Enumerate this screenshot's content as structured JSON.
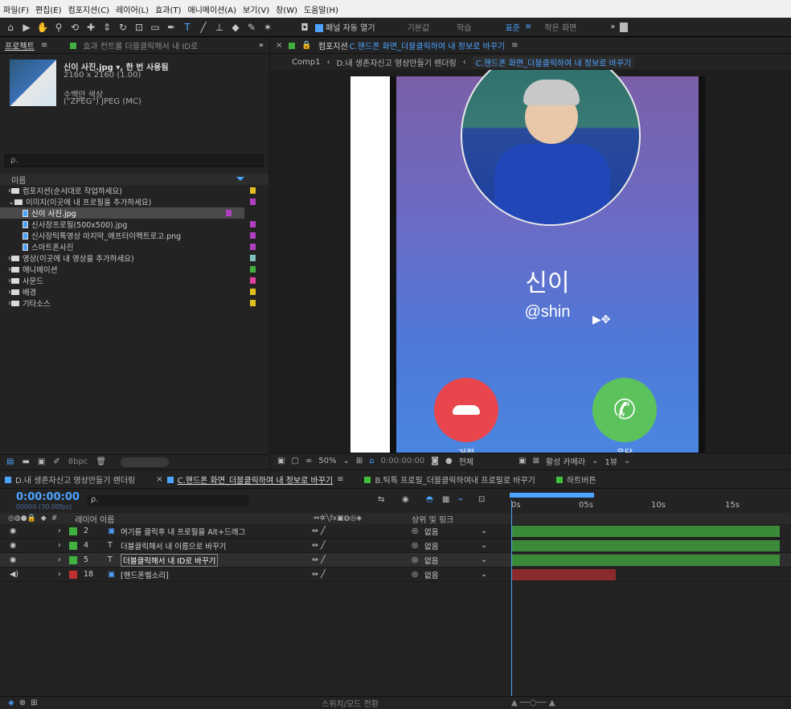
{
  "menu": [
    "파일(F)",
    "편집(E)",
    "컴포지션(C)",
    "레이어(L)",
    "효과(T)",
    "애니메이션(A)",
    "보기(V)",
    "창(W)",
    "도움말(H)"
  ],
  "toolbar": {
    "panel_auto_open": "패널 자동 열기",
    "workspaces": [
      "기본값",
      "학습",
      "표준",
      "작은 화면"
    ],
    "overflow": "»"
  },
  "project_panel": {
    "tab_project": "프로젝트",
    "tab_effects": "효과 컨트롤 더블클릭해서 내 ID로",
    "selected_name": "신이 사진.jpg ▾, 한 번 사용됨",
    "selected_dims": "2160 x 2160 (1.00)",
    "selected_color": "수백만 색상",
    "selected_format": "(\"ZPEG\") JPEG (MC)",
    "search_placeholder": "ρ.",
    "column_name": "이름",
    "bpc": "8bpc",
    "items": [
      {
        "type": "folder",
        "label": "컴포지션(순서대로 작업하세요)",
        "indent": 0,
        "color": "#e0c020"
      },
      {
        "type": "folder",
        "label": "이미지(이곳에 내 프로필을 추가하세요)",
        "indent": 0,
        "color": "#b040c0",
        "open": true
      },
      {
        "type": "file",
        "label": "신이 사진.jpg",
        "indent": 1,
        "color": "#b040c0",
        "selected": true
      },
      {
        "type": "file",
        "label": "신사장프로필(500x500).jpg",
        "indent": 1,
        "color": "#b040c0"
      },
      {
        "type": "file",
        "label": "신사장틱톡영상 마지막_애프터이펙트로고.png",
        "indent": 1,
        "color": "#b040c0"
      },
      {
        "type": "file",
        "label": "스마트폰사진",
        "indent": 1,
        "color": "#b040c0"
      },
      {
        "type": "folder",
        "label": "영상(이곳에 내 영상을 추가하세요)",
        "indent": 0,
        "color": "#80c0c0"
      },
      {
        "type": "folder",
        "label": "애니메이션",
        "indent": 0,
        "color": "#40b040"
      },
      {
        "type": "folder",
        "label": "사운드",
        "indent": 0,
        "color": "#e040a0"
      },
      {
        "type": "folder",
        "label": "배경",
        "indent": 0,
        "color": "#e0c020"
      },
      {
        "type": "folder",
        "label": "기타소스",
        "indent": 0,
        "color": "#e0c020"
      }
    ]
  },
  "viewer": {
    "tab_label": "컴포지션",
    "tab_comp": "C.핸드폰 화면_더블클릭하여 내 정보로 바꾸기",
    "breadcrumbs": [
      "Comp1",
      "D.내 생존자신고 영상만들기 렌더링",
      "C.핸드폰 화면_더블클릭하여 내 정보로 바꾸기"
    ],
    "caller_name": "신이",
    "caller_id": "@shin",
    "decline_label": "거절",
    "accept_label": "응답",
    "zoom": "50%",
    "timecode": "0:00:00:00",
    "resolution": "전체",
    "camera": "활성 카메라",
    "views": "1뷰"
  },
  "timeline": {
    "tabs": [
      {
        "label": "D.내 생존자신고 영상만들기 렌더링",
        "color": "#4da3ff",
        "active": false
      },
      {
        "label": "C.핸드폰 화면_더블클릭하여 내 정보로 바꾸기",
        "color": "#4da3ff",
        "active": true
      },
      {
        "label": "B.틱톡 프로필_더블클릭하여내 프로필로 바꾸기",
        "color": "#40c040",
        "active": false
      },
      {
        "label": "하트버튼",
        "color": "#40c040",
        "active": false
      }
    ],
    "timecode": "0:00:00:00",
    "fps": "00000 (30.00fps)",
    "col_layer_name": "레이어 이름",
    "col_parent": "상위 및 링크",
    "ruler": [
      "0s",
      "05s",
      "10s",
      "15s"
    ],
    "switch_mode": "스위치/모드 전환",
    "layers": [
      {
        "num": "2",
        "name": "여기를 클릭후 내 프로필을 Alt+드래그",
        "color": "#40b040",
        "track": "#3a8a3a",
        "parent": "없음"
      },
      {
        "num": "4",
        "name": "더블클릭해서 내 이름으로 바꾸기",
        "color": "#40b040",
        "track": "#3a8a3a",
        "parent": "없음",
        "text": true
      },
      {
        "num": "5",
        "name": "더블클릭해서 내 ID로 바꾸기",
        "color": "#40b040",
        "track": "#3a8a3a",
        "parent": "없음",
        "text": true,
        "selected": true
      },
      {
        "num": "18",
        "name": "[핸드폰벨소리]",
        "color": "#c03030",
        "track": "#8a2a2a",
        "parent": "없음"
      }
    ]
  }
}
